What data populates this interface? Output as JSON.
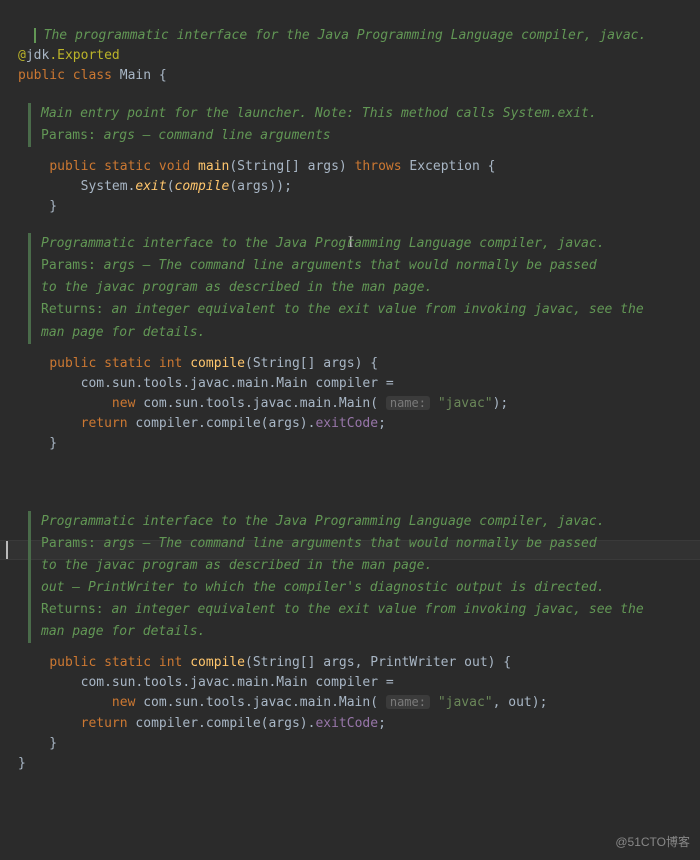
{
  "head": {
    "comment": "The programmatic interface for the Java Programming Language compiler, javac.",
    "anno_at": "@",
    "anno_pkg": "jdk",
    "anno_name": ".Exported",
    "class_decl": [
      "public",
      " ",
      "class",
      " Main {"
    ]
  },
  "m1": {
    "doc_l1": "Main entry point for the launcher. Note: This method calls System.exit.",
    "doc_l2a": "Params: ",
    "doc_l2b": "args – command line arguments",
    "sig": [
      "public",
      " ",
      "static",
      " ",
      "void",
      " ",
      "main",
      "(String[] args) ",
      "throws",
      " Exception {"
    ],
    "body_l1": [
      "        System.",
      "exit",
      "(",
      "compile",
      "(args));"
    ],
    "close": "    }"
  },
  "m2": {
    "doc_l1": "Programmatic interface to the Java Programming Language compiler, javac.",
    "doc_pk": "Params:  ",
    "doc_p1": "args – The command line arguments that would normally be passed",
    "doc_p2": "           to the javac program as described in the man page.",
    "doc_rk": "Returns: ",
    "doc_r1": "an integer equivalent to the exit value from invoking javac, see the",
    "doc_r2": "             man page for details.",
    "sig": [
      "public",
      " ",
      "static",
      " ",
      "int",
      " ",
      "compile",
      "(String[] args) {"
    ],
    "body_l1": "        com.sun.tools.javac.main.Main compiler =",
    "body_l2a": "            ",
    "body_l2b": "new",
    "body_l2c": " com.sun.tools.javac.main.Main( ",
    "body_l2hint": "name:",
    "body_l2d": " ",
    "body_l2e": "\"javac\"",
    "body_l2f": ");",
    "body_l3": [
      "        ",
      "return",
      " compiler.compile(args).",
      "exitCode",
      ";"
    ],
    "close": "    }"
  },
  "m3": {
    "doc_l1": "Programmatic interface to the Java Programming Language compiler, javac.",
    "doc_pk": "Params:  ",
    "doc_p1": "args – The command line arguments that would normally be passed",
    "doc_p2": "           to the javac program as described in the man page.",
    "doc_p3": "           out – PrintWriter to which the compiler's diagnostic output is directed.",
    "doc_rk": "Returns: ",
    "doc_r1": "an integer equivalent to the exit value from invoking javac, see the",
    "doc_r2": "             man page for details.",
    "sig": [
      "public",
      " ",
      "static",
      " ",
      "int",
      " ",
      "compile",
      "(String[] args, PrintWriter out) {"
    ],
    "body_l1": "        com.sun.tools.javac.main.Main compiler =",
    "body_l2a": "            ",
    "body_l2b": "new",
    "body_l2c": " com.sun.tools.javac.main.Main( ",
    "body_l2hint": "name:",
    "body_l2d": " ",
    "body_l2e": "\"javac\"",
    "body_l2f": ", out);",
    "body_l3": [
      "        ",
      "return",
      " compiler.compile(args).",
      "exitCode",
      ";"
    ],
    "close": "    }"
  },
  "tail": {
    "class_close": "}"
  },
  "watermark": "@51CTO博客"
}
